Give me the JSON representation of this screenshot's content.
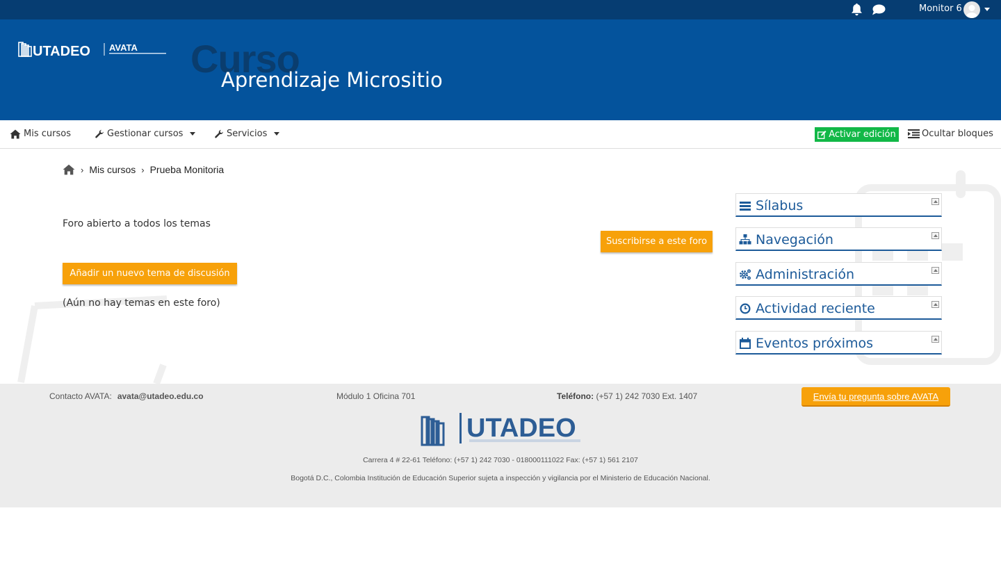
{
  "topbar": {
    "user_name": "Monitor 6",
    "icons": [
      "bell-icon",
      "chat-icon",
      "avatar",
      "caret-down-icon"
    ]
  },
  "banner": {
    "logo_brand": "UTADEO",
    "logo_product": "AVATA",
    "background_word": "Curso",
    "course_title": "Aprendizaje Micrositio"
  },
  "nav": {
    "items": [
      {
        "label": "Mis cursos",
        "icon": "home-icon"
      },
      {
        "label": "Gestionar cursos",
        "icon": "wrench-icon"
      },
      {
        "label": "Servicios",
        "icon": "wrench-icon"
      }
    ],
    "edit_label": "Activar edición",
    "hide_blocks_label": "Ocultar bloques"
  },
  "breadcrumb": {
    "items": [
      "Mis cursos",
      "Prueba Monitoria"
    ]
  },
  "main": {
    "forum_intro": "Foro abierto a todos los temas",
    "subscribe_label": "Suscribirse a este foro",
    "add_topic_label": "Añadir un nuevo tema de discusión",
    "empty_message": "(Aún no hay temas en este foro)"
  },
  "sidebar": {
    "blocks": [
      {
        "title": "Sílabus",
        "icon": "list-icon"
      },
      {
        "title": "Navegación",
        "icon": "sitemap-icon"
      },
      {
        "title": "Administración",
        "icon": "cogs-icon"
      },
      {
        "title": "Actividad reciente",
        "icon": "clock-icon"
      },
      {
        "title": "Eventos próximos",
        "icon": "calendar-icon"
      }
    ]
  },
  "footer": {
    "contact_label": "Contacto AVATA:",
    "contact_email": "avata@utadeo.edu.co",
    "office": "Módulo 1 Oficina 701",
    "phone_label": "Teléfono:",
    "phone_value": "(+57 1) 242 7030 Ext. 1407",
    "ask_label": "Envía tu pregunta sobre AVATA",
    "logo_brand": "UTADEO",
    "address": "Carrera 4 # 22-61 Teléfono: (+57 1) 242 7030 - 018000111022 Fax: (+57 1) 561 2107",
    "legal": "Bogotá D.C., Colombia Institución de Educación Superior sujeta a inspección y vigilancia por el Ministerio de Educación Nacional."
  },
  "colors": {
    "topbar": "#063d72",
    "banner": "#04539c",
    "accent_orange": "#f7a10a",
    "edit_green": "#12b847",
    "block_title": "#1c5a99"
  }
}
